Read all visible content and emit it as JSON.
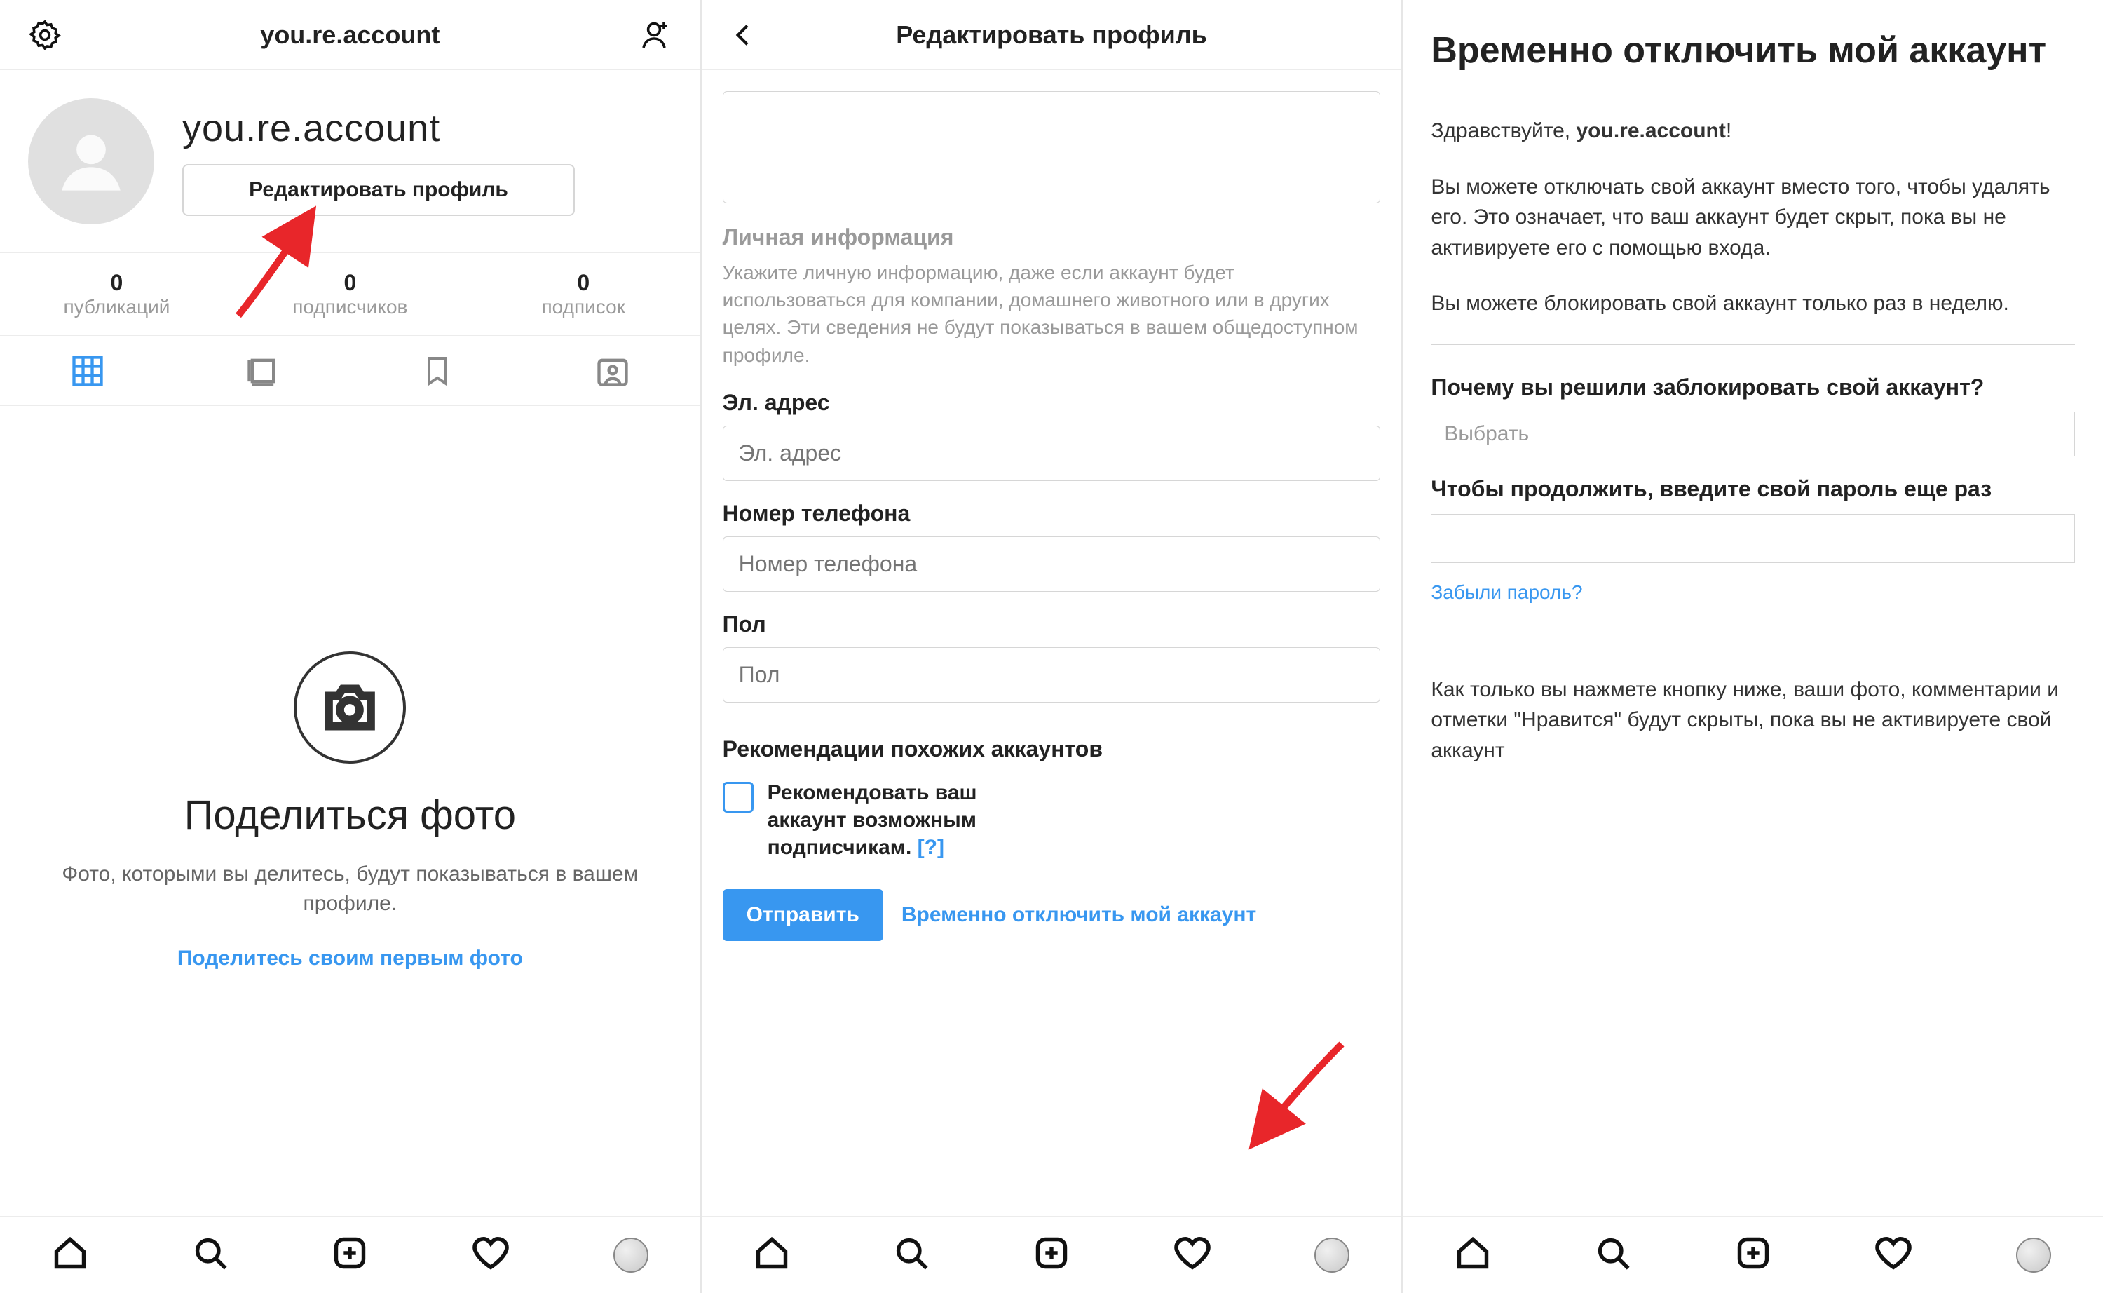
{
  "pane1": {
    "header_username": "you.re.account",
    "profile_name": "you.re.account",
    "edit_button": "Редактировать профиль",
    "stats": [
      {
        "count": "0",
        "label": "публикаций"
      },
      {
        "count": "0",
        "label": "подписчиков"
      },
      {
        "count": "0",
        "label": "подписок"
      }
    ],
    "empty": {
      "title": "Поделиться фото",
      "desc": "Фото, которыми вы делитесь, будут показываться в вашем профиле.",
      "link": "Поделитесь своим первым фото"
    }
  },
  "pane2": {
    "header_title": "Редактировать профиль",
    "personal_info_title": "Личная информация",
    "personal_info_desc": "Укажите личную информацию, даже если аккаунт будет использоваться для компании, домашнего животного или в других целях. Эти сведения не будут показываться в вашем общедоступном профиле.",
    "email_label": "Эл. адрес",
    "email_placeholder": "Эл. адрес",
    "phone_label": "Номер телефона",
    "phone_placeholder": "Номер телефона",
    "gender_label": "Пол",
    "gender_placeholder": "Пол",
    "rec_title": "Рекомендации похожих аккаунтов",
    "rec_text": "Рекомендовать ваш аккаунт возможным подписчикам.",
    "rec_help": "[?]",
    "submit": "Отправить",
    "disable_link": "Временно отключить мой аккаунт"
  },
  "pane3": {
    "title": "Временно отключить мой аккаунт",
    "greeting_prefix": "Здравствуйте, ",
    "greeting_user": "you.re.account",
    "greeting_suffix": "!",
    "para1": "Вы можете отключать свой аккаунт вместо того, чтобы удалять его. Это означает, что ваш аккаунт будет скрыт, пока вы не активируете его с помощью входа.",
    "para2": "Вы можете блокировать свой аккаунт только раз в неделю.",
    "reason_label": "Почему вы решили заблокировать свой аккаунт?",
    "reason_placeholder": "Выбрать",
    "password_label": "Чтобы продолжить, введите свой пароль еще раз",
    "forgot": "Забыли пароль?",
    "footer": "Как только вы нажмете кнопку ниже, ваши фото, комментарии и отметки \"Нравится\" будут скрыты, пока вы не активируете свой аккаунт"
  }
}
